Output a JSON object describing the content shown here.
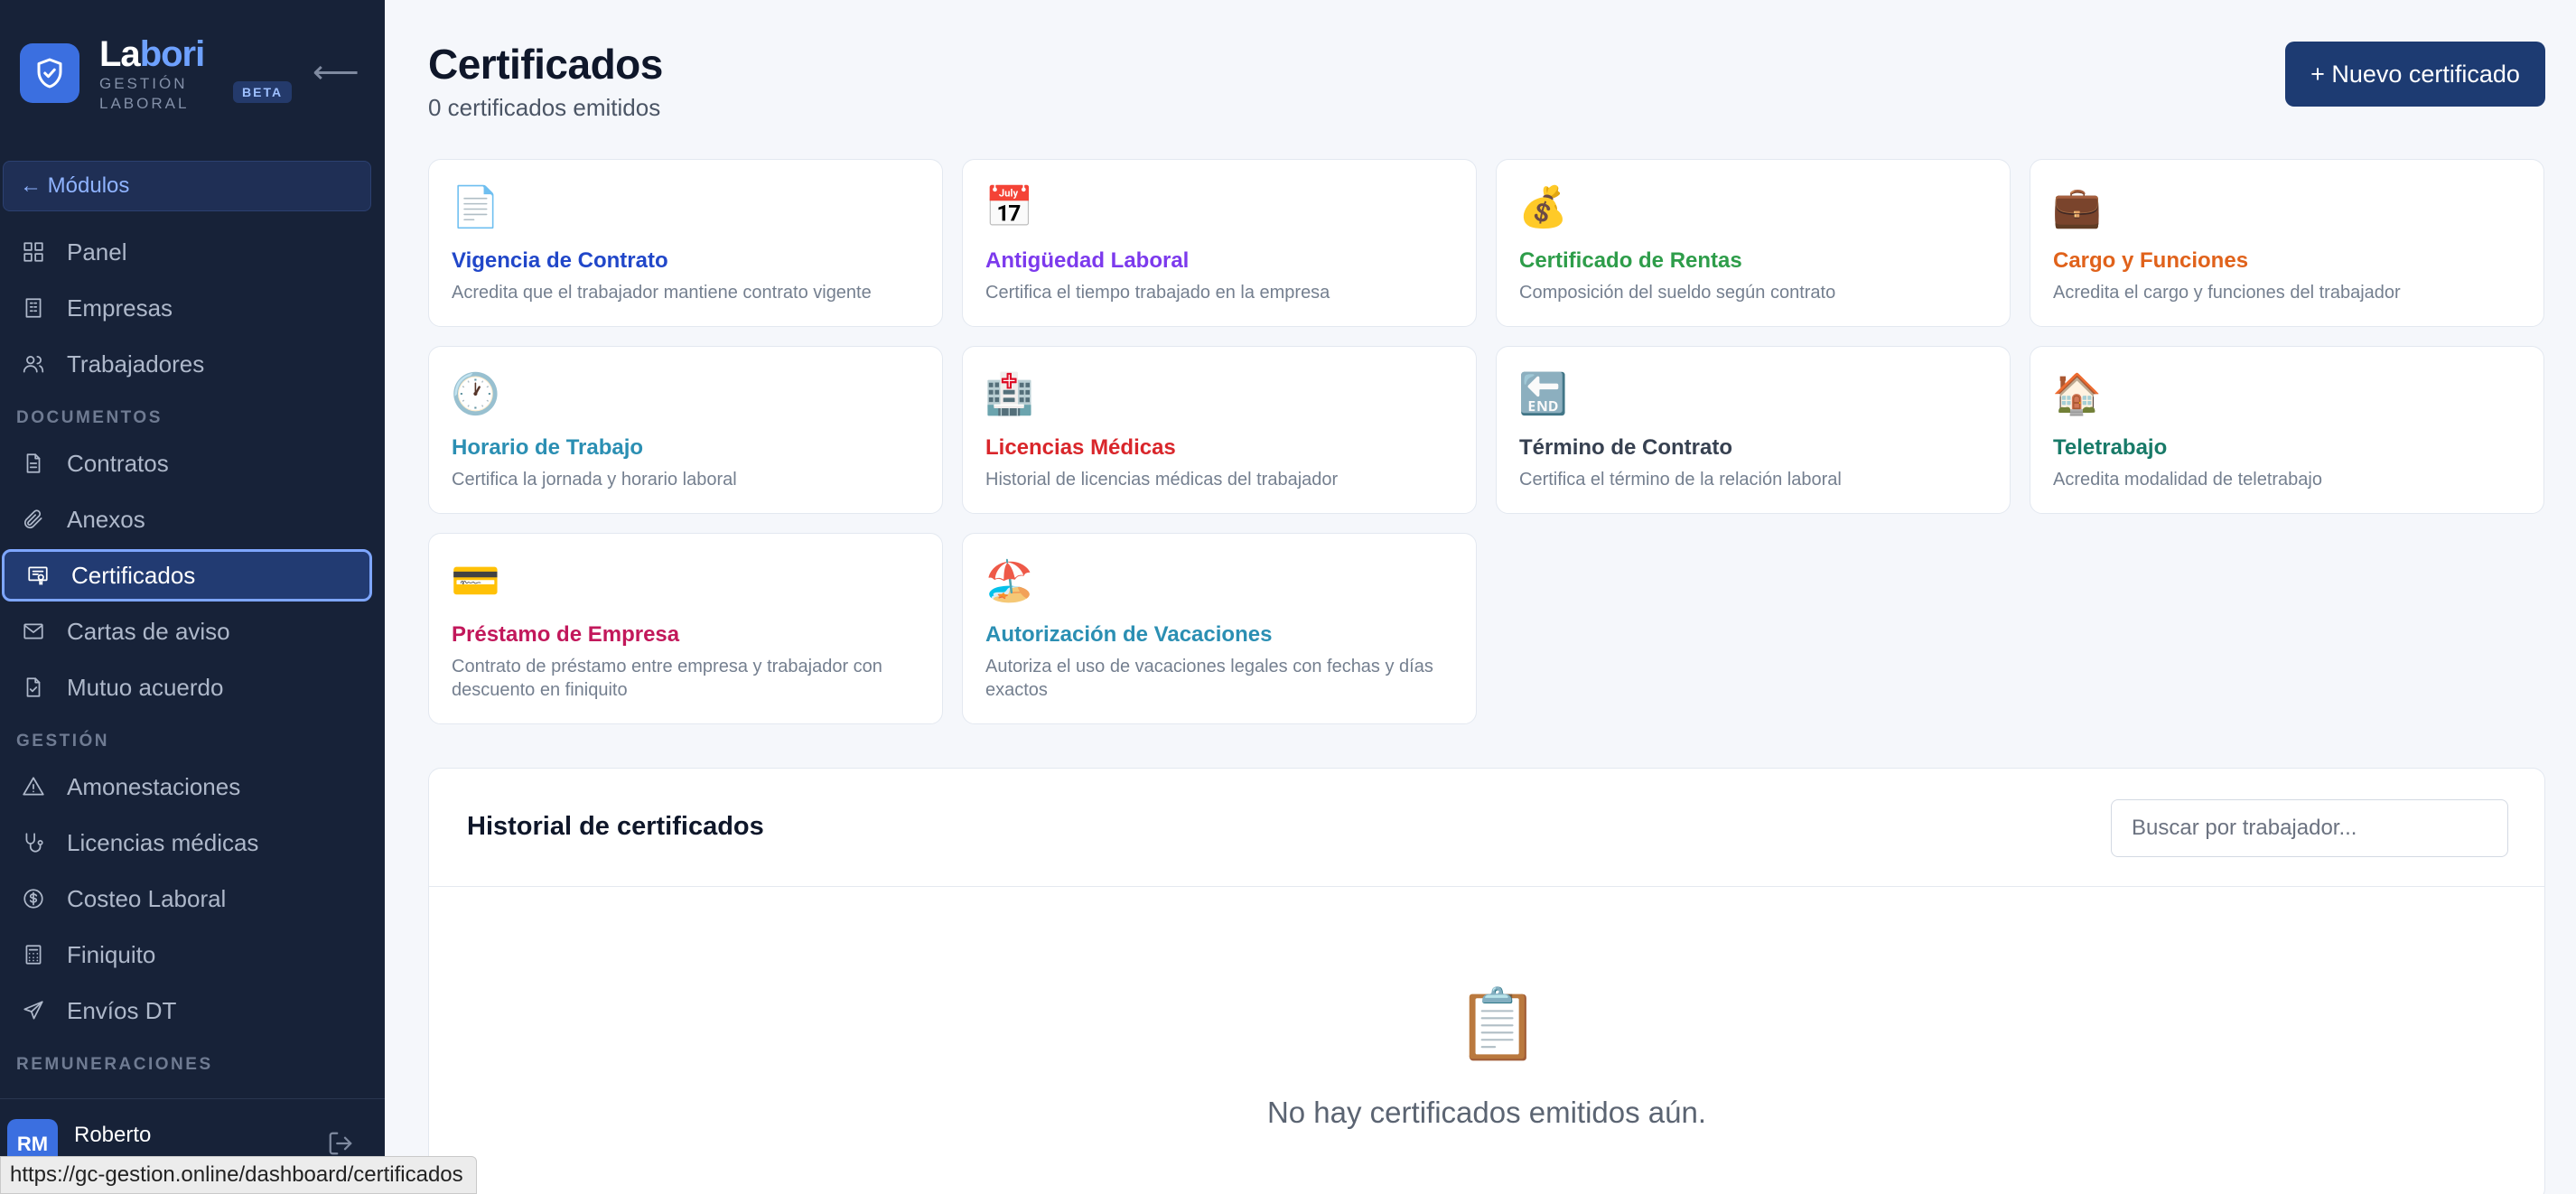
{
  "brand": {
    "name_a": "La",
    "name_b": "bori",
    "sub": "GESTIÓN LABORAL",
    "badge": "BETA",
    "collapse": "⟵"
  },
  "sidebar": {
    "modules": "← Módulos",
    "top_items": [
      {
        "label": "Panel",
        "icon": "dashboard-icon"
      },
      {
        "label": "Empresas",
        "icon": "building-icon"
      },
      {
        "label": "Trabajadores",
        "icon": "users-icon"
      }
    ],
    "sections": [
      {
        "label": "DOCUMENTOS",
        "items": [
          {
            "label": "Contratos",
            "icon": "document-icon"
          },
          {
            "label": "Anexos",
            "icon": "paperclip-icon"
          },
          {
            "label": "Certificados",
            "icon": "certificate-icon",
            "active": true
          },
          {
            "label": "Cartas de aviso",
            "icon": "mail-icon"
          },
          {
            "label": "Mutuo acuerdo",
            "icon": "document-check-icon"
          }
        ]
      },
      {
        "label": "GESTIÓN",
        "items": [
          {
            "label": "Amonestaciones",
            "icon": "warning-icon"
          },
          {
            "label": "Licencias médicas",
            "icon": "stethoscope-icon"
          },
          {
            "label": "Costeo Laboral",
            "icon": "dollar-icon"
          },
          {
            "label": "Finiquito",
            "icon": "calculator-icon"
          },
          {
            "label": "Envíos DT",
            "icon": "send-icon"
          }
        ]
      },
      {
        "label": "REMUNERACIONES",
        "items": []
      }
    ],
    "user": {
      "initials": "RM",
      "name": "Roberto"
    }
  },
  "status_url": "https://gc-gestion.online/dashboard/certificados",
  "header": {
    "title": "Certificados",
    "subtitle": "0 certificados emitidos",
    "new_button": "+ Nuevo certificado"
  },
  "cards": [
    {
      "emoji": "📄",
      "title": "Vigencia de Contrato",
      "desc": "Acredita que el trabajador mantiene contrato vigente",
      "color": "#2147c9"
    },
    {
      "emoji": "📅",
      "title": "Antigüedad Laboral",
      "desc": "Certifica el tiempo trabajado en la empresa",
      "color": "#7c3aed"
    },
    {
      "emoji": "💰",
      "title": "Certificado de Rentas",
      "desc": "Composición del sueldo según contrato",
      "color": "#2e9d4a"
    },
    {
      "emoji": "💼",
      "title": "Cargo y Funciones",
      "desc": "Acredita el cargo y funciones del trabajador",
      "color": "#e0621b"
    },
    {
      "emoji": "🕐",
      "title": "Horario de Trabajo",
      "desc": "Certifica la jornada y horario laboral",
      "color": "#2b8fb3"
    },
    {
      "emoji": "🏥",
      "title": "Licencias Médicas",
      "desc": "Historial de licencias médicas del trabajador",
      "color": "#d9262b"
    },
    {
      "emoji": "🔚",
      "title": "Término de Contrato",
      "desc": "Certifica el término de la relación laboral",
      "color": "#374151"
    },
    {
      "emoji": "🏠",
      "title": "Teletrabajo",
      "desc": "Acredita modalidad de teletrabajo",
      "color": "#187a68"
    },
    {
      "emoji": "💳",
      "title": "Préstamo de Empresa",
      "desc": "Contrato de préstamo entre empresa y trabajador con descuento en finiquito",
      "color": "#c2185b"
    },
    {
      "emoji": "🏖️",
      "title": "Autorización de Vacaciones",
      "desc": "Autoriza el uso de vacaciones legales con fechas y días exactos",
      "color": "#2b8fb3"
    }
  ],
  "history": {
    "title": "Historial de certificados",
    "search_placeholder": "Buscar por trabajador...",
    "empty_icon": "📋",
    "empty_text": "No hay certificados emitidos aún."
  },
  "colors": {
    "sidebar_bg": "#172238",
    "accent": "#3b6fe0",
    "primary_button": "#1d3b72"
  }
}
